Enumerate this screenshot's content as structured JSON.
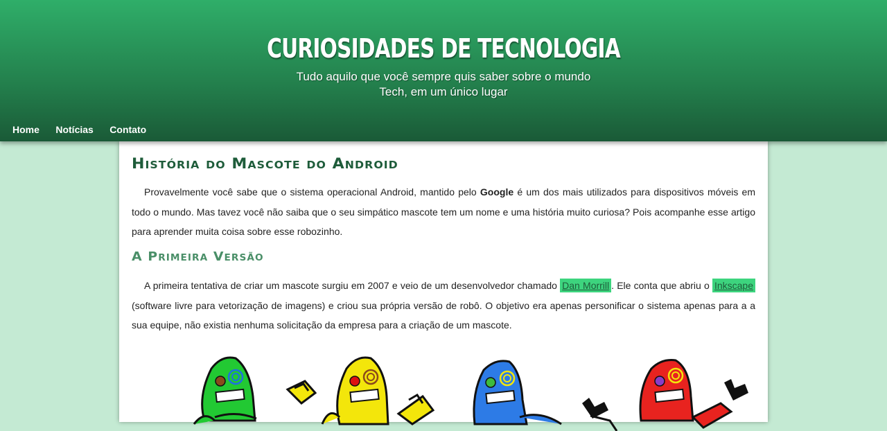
{
  "header": {
    "title": "CURIOSIDADES DE TECNOLOGIA",
    "tagline_line1": "Tudo aquilo que você sempre quis saber sobre o mundo",
    "tagline_line2": "Tech, em um único lugar"
  },
  "nav": {
    "items": [
      {
        "label": "Home"
      },
      {
        "label": "Notícias"
      },
      {
        "label": "Contato"
      }
    ]
  },
  "article": {
    "title": "História do Mascote do Android",
    "intro_before": "Provavelmente você sabe que o sistema operacional Android, mantido pelo ",
    "intro_bold": "Google",
    "intro_after": " é um dos mais utilizados para dispositivos móveis em todo o mundo. Mas tavez você não saiba que o seu simpático mascote tem um nome e uma história muito curiosa? Pois acompanhe esse artigo para aprender muita coisa sobre esse robozinho.",
    "section_title": "A Primeira Versão",
    "p2_part1": "A primeira tentativa de criar um mascote surgiu em 2007 e veio de um desenvolvedor chamado ",
    "link1": "Dan Morrill",
    "p2_part2": ". Ele conta que abriu o ",
    "link2": "Inkscape",
    "p2_part3": " (software livre para vetorização de imagens) e criou sua própria versão de robô. O objetivo era apenas personificar o sistema apenas para a a sua equipe, não existia nenhuma solicitação da empresa para a criação de um mascote."
  },
  "colors": {
    "header_green": "#237f4c",
    "page_background": "#c4ead3",
    "highlight": "#3dd47e",
    "heading_green": "#1e5c3a"
  },
  "image": {
    "icon": "robot-mascots-illustration"
  }
}
